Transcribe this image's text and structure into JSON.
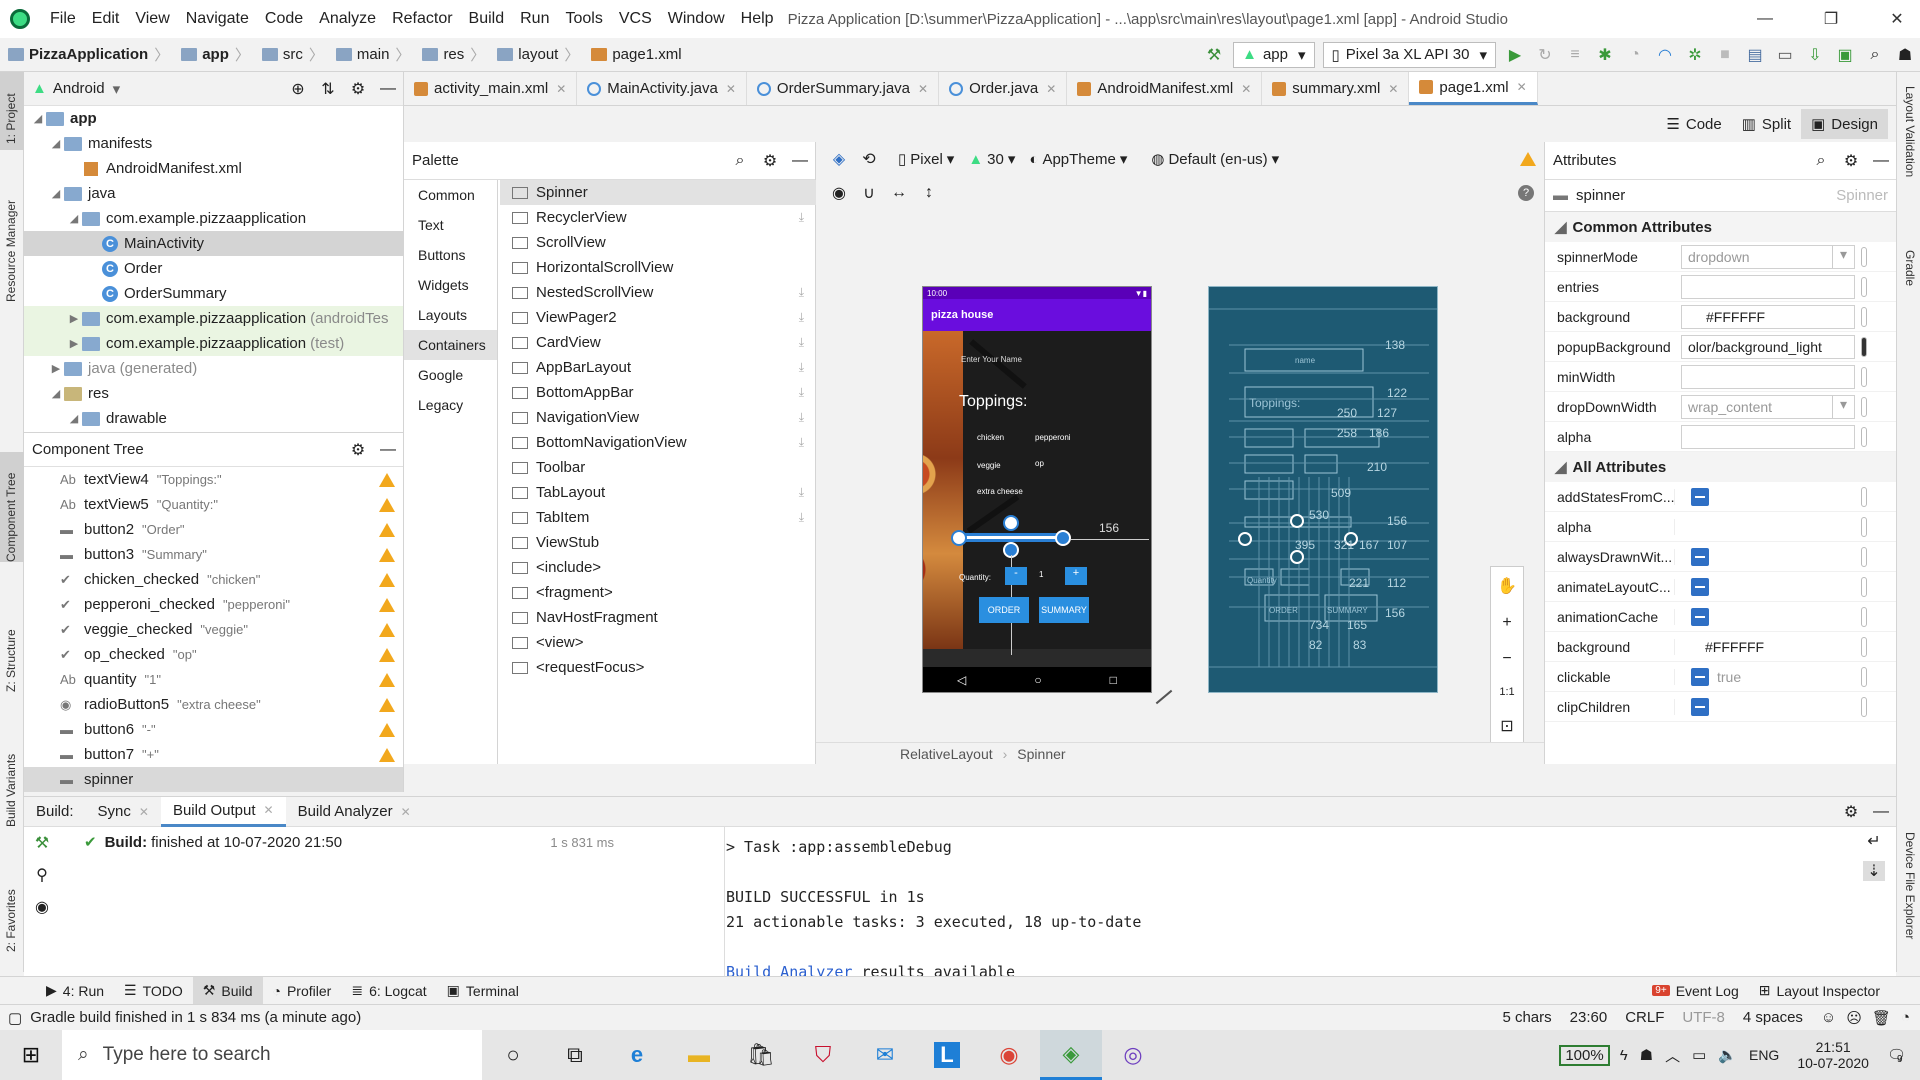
{
  "window": {
    "menu": [
      "File",
      "Edit",
      "View",
      "Navigate",
      "Code",
      "Analyze",
      "Refactor",
      "Build",
      "Run",
      "Tools",
      "VCS",
      "Window",
      "Help"
    ],
    "title": "Pizza Application [D:\\summer\\PizzaApplication] - ...\\app\\src\\main\\res\\layout\\page1.xml [app] - Android Studio"
  },
  "breadcrumb": [
    "PizzaApplication",
    "app",
    "src",
    "main",
    "res",
    "layout",
    "page1.xml"
  ],
  "toolbar": {
    "run_config": "app",
    "device": "Pixel 3a XL API 30"
  },
  "project": {
    "view_label": "Android",
    "tree": [
      {
        "label": "app",
        "bold": true
      },
      {
        "label": "manifests"
      },
      {
        "label": "AndroidManifest.xml"
      },
      {
        "label": "java"
      },
      {
        "label": "com.example.pizzaapplication"
      },
      {
        "label": "MainActivity"
      },
      {
        "label": "Order"
      },
      {
        "label": "OrderSummary"
      },
      {
        "label": "com.example.pizzaapplication",
        "suffix": "(androidTes"
      },
      {
        "label": "com.example.pizzaapplication",
        "suffix": "(test)"
      },
      {
        "label": "java (generated)"
      },
      {
        "label": "res"
      },
      {
        "label": "drawable"
      }
    ]
  },
  "component_tree": {
    "title": "Component Tree",
    "items": [
      {
        "icon": "Ab",
        "name": "textView4",
        "text": "\"Toppings:\""
      },
      {
        "icon": "Ab",
        "name": "textView5",
        "text": "\"Quantity:\""
      },
      {
        "icon": "▬",
        "name": "button2",
        "text": "\"Order\""
      },
      {
        "icon": "▬",
        "name": "button3",
        "text": "\"Summary\""
      },
      {
        "icon": "✔",
        "name": "chicken_checked",
        "text": "\"chicken\""
      },
      {
        "icon": "✔",
        "name": "pepperoni_checked",
        "text": "\"pepperoni\""
      },
      {
        "icon": "✔",
        "name": "veggie_checked",
        "text": "\"veggie\""
      },
      {
        "icon": "✔",
        "name": "op_checked",
        "text": "\"op\""
      },
      {
        "icon": "Ab",
        "name": "quantity",
        "text": "\"1\""
      },
      {
        "icon": "◉",
        "name": "radioButton5",
        "text": "\"extra cheese\""
      },
      {
        "icon": "▬",
        "name": "button6",
        "text": "\"-\""
      },
      {
        "icon": "▬",
        "name": "button7",
        "text": "\"+\""
      },
      {
        "icon": "▬",
        "name": "spinner",
        "text": ""
      }
    ]
  },
  "editor_tabs": [
    "activity_main.xml",
    "MainActivity.java",
    "OrderSummary.java",
    "Order.java",
    "AndroidManifest.xml",
    "summary.xml",
    "page1.xml"
  ],
  "modes": [
    "Code",
    "Split",
    "Design"
  ],
  "palette": {
    "title": "Palette",
    "categories": [
      "Common",
      "Text",
      "Buttons",
      "Widgets",
      "Layouts",
      "Containers",
      "Google",
      "Legacy"
    ],
    "items": [
      "Spinner",
      "RecyclerView",
      "ScrollView",
      "HorizontalScrollView",
      "NestedScrollView",
      "ViewPager2",
      "CardView",
      "AppBarLayout",
      "BottomAppBar",
      "NavigationView",
      "BottomNavigationView",
      "Toolbar",
      "TabLayout",
      "TabItem",
      "ViewStub",
      "<include>",
      "<fragment>",
      "NavHostFragment",
      "<view>",
      "<requestFocus>"
    ]
  },
  "design_toolbar": {
    "device": "Pixel",
    "api": "30",
    "theme": "AppTheme",
    "locale": "Default (en-us)"
  },
  "phone": {
    "time": "10:00",
    "app_title": "pizza house",
    "name_hint": "Enter Your Name",
    "toppings": "Toppings:",
    "chicken": "chicken",
    "pepperoni": "pepperoni",
    "veggie": "veggie",
    "op": "op",
    "extra_cheese": "extra cheese",
    "quantity": "Quantity:",
    "minus": "-",
    "qty_value": "1",
    "plus": "+",
    "order": "ORDER",
    "summary": "SUMMARY",
    "margin": "156"
  },
  "blueprint": {
    "nums": [
      "138",
      "122",
      "250",
      "127",
      "258",
      "186",
      "210",
      "509",
      "156",
      "530",
      "395",
      "321",
      "167",
      "107",
      "221",
      "112",
      "734",
      "165",
      "156",
      "82",
      "83"
    ],
    "labels": [
      "name",
      "Toppings:",
      "Quantity",
      "ORDER",
      "SUMMARY"
    ]
  },
  "attributes": {
    "title": "Attributes",
    "widget": "spinner",
    "widget_hint": "Spinner",
    "common_title": "Common Attributes",
    "common": [
      {
        "name": "spinnerMode",
        "value": "dropdown",
        "dropdown": true
      },
      {
        "name": "entries",
        "value": ""
      },
      {
        "name": "background",
        "value": "#FFFFFF"
      },
      {
        "name": "popupBackground",
        "value": "olor/background_light"
      },
      {
        "name": "minWidth",
        "value": ""
      },
      {
        "name": "dropDownWidth",
        "value": "wrap_content",
        "dropdown": true
      },
      {
        "name": "alpha",
        "value": ""
      }
    ],
    "all_title": "All Attributes",
    "all": [
      {
        "name": "addStatesFromC...",
        "flag": true,
        "value": ""
      },
      {
        "name": "alpha",
        "flag": false,
        "value": ""
      },
      {
        "name": "alwaysDrawnWit...",
        "flag": true,
        "value": ""
      },
      {
        "name": "animateLayoutC...",
        "flag": true,
        "value": ""
      },
      {
        "name": "animationCache",
        "flag": true,
        "value": ""
      },
      {
        "name": "background",
        "flag": false,
        "value": "#FFFFFF"
      },
      {
        "name": "clickable",
        "flag": true,
        "value": "true"
      },
      {
        "name": "clipChildren",
        "flag": true,
        "value": ""
      }
    ]
  },
  "breadcrumb_bottom": [
    "RelativeLayout",
    "Spinner"
  ],
  "build": {
    "tabs": [
      "Build:",
      "Sync",
      "Build Output",
      "Build Analyzer"
    ],
    "status_bold": "Build:",
    "status_text": "finished at 10-07-2020 21:50",
    "duration": "1 s 831 ms",
    "output": [
      "> Task :app:assembleDebug",
      "",
      "BUILD SUCCESSFUL in 1s",
      "21 actionable tasks: 3 executed, 18 up-to-date",
      ""
    ],
    "analyzer_link": "Build Analyzer",
    "analyzer_rest": " results available"
  },
  "tools": [
    "4: Run",
    "TODO",
    "Build",
    "Profiler",
    "6: Logcat",
    "Terminal"
  ],
  "tools_right": [
    "Event Log",
    "Layout Inspector"
  ],
  "status": {
    "message": "Gradle build finished in 1 s 834 ms (a minute ago)",
    "chars": "5 chars",
    "pos": "23:60",
    "crlf": "CRLF",
    "enc": "UTF-8",
    "indent": "4 spaces"
  },
  "left_strip": [
    "1: Project",
    "Resource Manager",
    "Component Tree",
    "Z: Structure",
    "Build Variants",
    "2: Favorites"
  ],
  "right_strip": [
    "Layout Validation",
    "Gradle",
    "Device File Explorer"
  ],
  "taskbar": {
    "search_placeholder": "Type here to search",
    "battery": "100%",
    "lang": "ENG",
    "time": "21:51",
    "date": "10-07-2020",
    "notif": "9"
  }
}
